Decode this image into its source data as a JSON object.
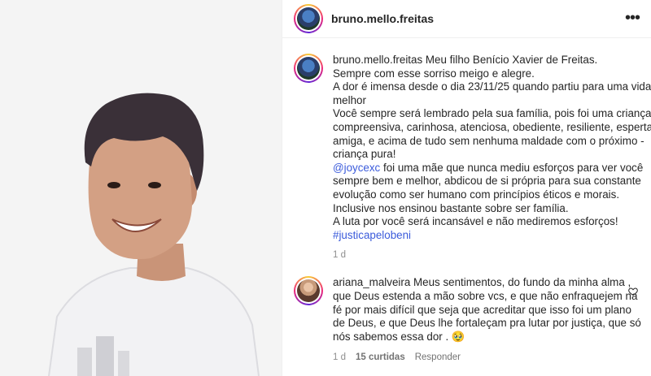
{
  "header": {
    "username": "bruno.mello.freitas",
    "more_label": "•••"
  },
  "post": {
    "username": "bruno.mello.freitas",
    "caption_lines": [
      " Meu filho Benício Xavier de Freitas.",
      "Sempre com esse sorriso meigo e alegre.",
      "A dor é imensa desde o dia 23/11/25 quando partiu para uma vida",
      "melhor",
      "Você sempre será lembrado pela sua família, pois foi uma criança",
      "compreensiva, carinhosa, atenciosa, obediente, resiliente, esperta,",
      "amiga, e acima de tudo sem nenhuma maldade com o próximo -",
      "criança pura!"
    ],
    "mention": "@joycexc",
    "mention_rest": " foi uma mãe que nunca mediu esforços para ver você",
    "caption_lines_2": [
      "sempre bem e melhor, abdicou de si própria para sua constante",
      "evolução como ser humano com princípios éticos e morais.",
      "Inclusive nos ensinou bastante sobre ser família.",
      "A luta por você será incansável e não mediremos esforços!"
    ],
    "hashtag": "#justicapelobeni",
    "time": "1 d"
  },
  "comment": {
    "username": "ariana_malveira",
    "lines": [
      " Meus sentimentos, do fundo da minha alma ,",
      "que Deus estenda a mão sobre vcs, e que não enfraquejem na",
      "fé por mais difícil que seja que acreditar que isso foi um plano",
      "de Deus, e que Deus lhe fortaleçam pra lutar por justiça, que só",
      "nós sabemos essa dor . 🥹"
    ],
    "time": "1 d",
    "likes": "15 curtidas",
    "reply_label": "Responder"
  },
  "icons": {
    "more": "more-options-icon",
    "heart": "heart-icon"
  }
}
